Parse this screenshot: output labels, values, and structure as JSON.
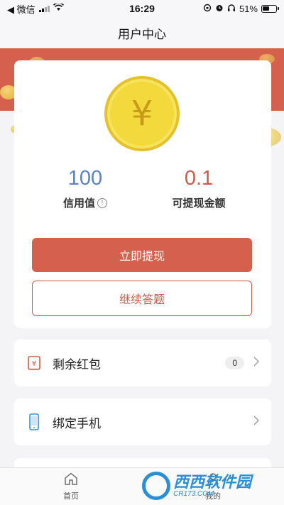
{
  "status_bar": {
    "back_app": "◀ 微信",
    "time": "16:29",
    "battery": "51%"
  },
  "nav": {
    "title": "用户中心"
  },
  "card": {
    "coin_symbol": "¥",
    "credit_value": "100",
    "credit_label": "信用值",
    "withdrawable_value": "0.1",
    "withdrawable_label": "可提现金额",
    "withdraw_button": "立即提现",
    "continue_button": "继续答题"
  },
  "list": [
    {
      "label": "剩余红包",
      "badge": "0",
      "icon": "red-envelope-icon"
    },
    {
      "label": "绑定手机",
      "icon": "phone-icon"
    }
  ],
  "tabs": [
    {
      "label": "首页",
      "icon": "home-icon"
    },
    {
      "label": "我的",
      "icon": "user-icon"
    }
  ],
  "watermark": {
    "main": "西西软件园",
    "sub": "CR173.COM"
  },
  "colors": {
    "accent": "#d4604d",
    "credit": "#5b84c4",
    "coin": "#f4d93c"
  }
}
